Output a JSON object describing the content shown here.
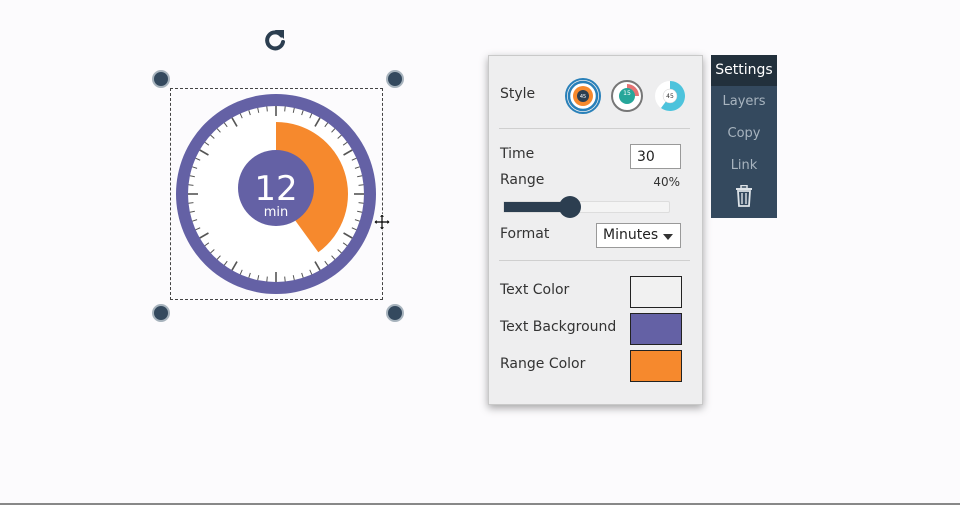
{
  "timer": {
    "value": "12",
    "unit": "min",
    "range_percent": 40,
    "colors": {
      "ring": "#6461a5",
      "range": "#f6892d",
      "face": "#ffffff",
      "text": "#ffffff"
    }
  },
  "icons": {
    "rotate": "rotate-icon",
    "move": "move-cursor-icon",
    "delete": "trash-icon"
  },
  "settings": {
    "style_label": "Style",
    "style_options": [
      {
        "name": "ring-style",
        "label": "45",
        "selected": true
      },
      {
        "name": "gauge-style",
        "label": "15",
        "selected": false
      },
      {
        "name": "pie-style",
        "label": "45",
        "selected": false
      }
    ],
    "time_label": "Time",
    "time_value": "30",
    "range_label": "Range",
    "range_value_text": "40%",
    "range_fraction": 0.4,
    "format_label": "Format",
    "format_value": "Minutes",
    "text_color_label": "Text Color",
    "text_color": "#f1f1f1",
    "text_background_label": "Text Background",
    "text_background": "#6461a5",
    "range_color_label": "Range Color",
    "range_color": "#f6892d"
  },
  "tabs": [
    {
      "label": "Settings",
      "active": true
    },
    {
      "label": "Layers",
      "active": false
    },
    {
      "label": "Copy",
      "active": false
    },
    {
      "label": "Link",
      "active": false
    }
  ]
}
